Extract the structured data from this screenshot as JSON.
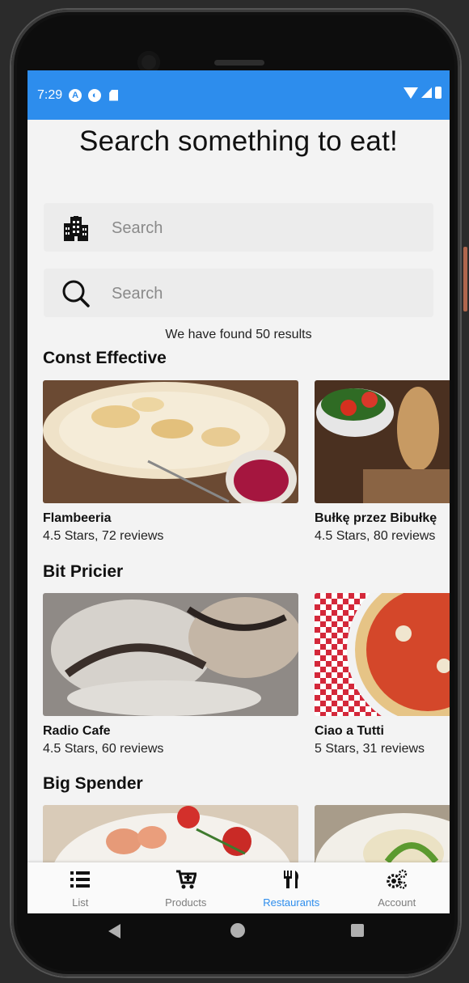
{
  "status_bar": {
    "time": "7:29",
    "icons": [
      "a-icon",
      "sync-icon",
      "sd-card-icon"
    ],
    "right_icons": [
      "wifi-icon",
      "signal-icon",
      "battery-icon"
    ],
    "color": "#2d8ded"
  },
  "page": {
    "title": "Search something to eat!"
  },
  "search": {
    "city_placeholder": "Search",
    "city_icon": "city-icon",
    "food_placeholder": "Search",
    "food_icon": "search-icon"
  },
  "results_text": "We have found 50 results",
  "sections": [
    {
      "title": "Const Effective",
      "cards": [
        {
          "name": "Flambeeria",
          "meta": "4.5 Stars, 72 reviews"
        },
        {
          "name": "Bułkę przez Bibułkę",
          "meta": "4.5 Stars, 80 reviews"
        }
      ]
    },
    {
      "title": "Bit Pricier",
      "cards": [
        {
          "name": "Radio Cafe",
          "meta": "4.5 Stars, 60 reviews"
        },
        {
          "name": "Ciao a Tutti",
          "meta": "5 Stars, 31 reviews"
        }
      ]
    },
    {
      "title": "Big Spender",
      "cards": [
        {
          "name": "",
          "meta": ""
        },
        {
          "name": "",
          "meta": ""
        }
      ]
    }
  ],
  "tabs": [
    {
      "label": "List",
      "icon": "list-icon",
      "active": false
    },
    {
      "label": "Products",
      "icon": "cart-plus-icon",
      "active": false
    },
    {
      "label": "Restaurants",
      "icon": "utensils-icon",
      "active": true
    },
    {
      "label": "Account",
      "icon": "gears-icon",
      "active": false
    }
  ],
  "colors": {
    "accent": "#2d8ded",
    "tab_inactive": "#7d7d7d"
  }
}
